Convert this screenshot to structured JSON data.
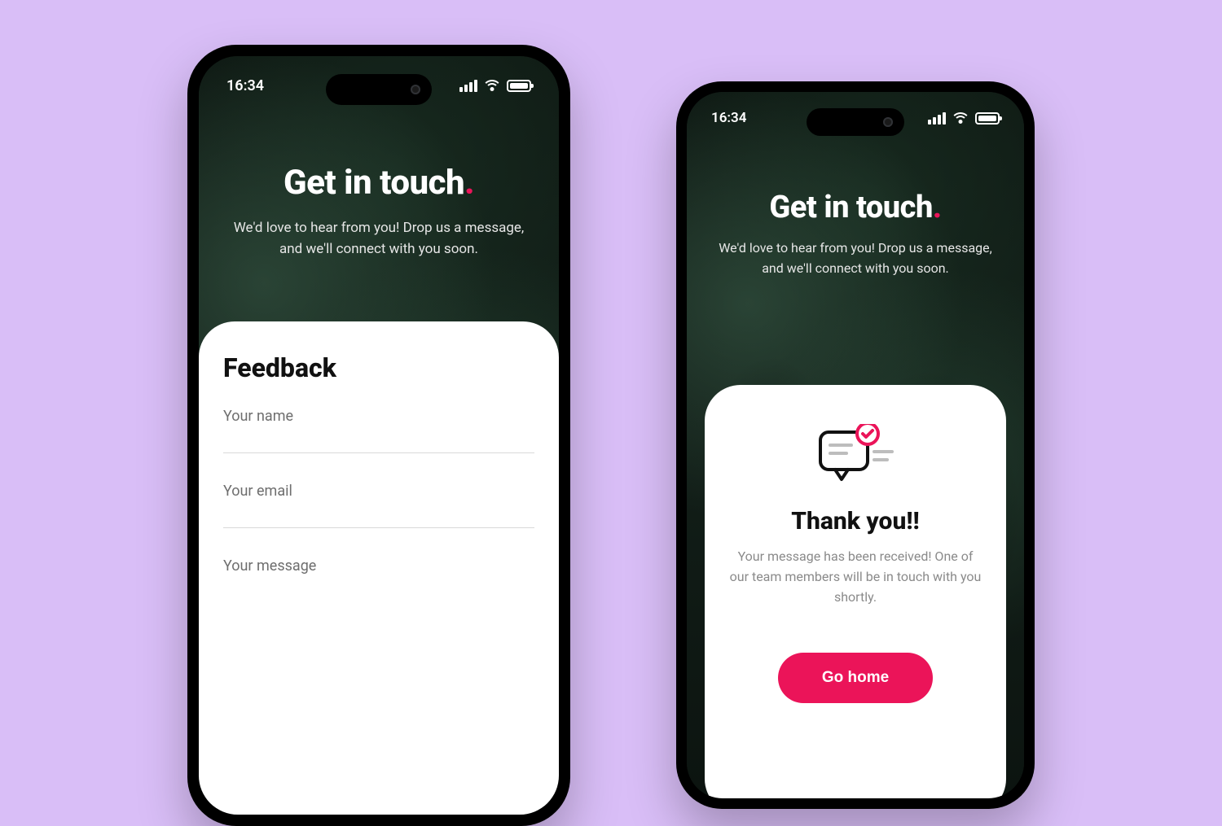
{
  "colors": {
    "accent": "#EB1459",
    "bg": "#D9BEF7"
  },
  "status": {
    "time": "16:34"
  },
  "hero": {
    "title": "Get in touch",
    "title_dot": ".",
    "subtitle": "We'd love to hear from you! Drop us a message, and we'll connect with you soon."
  },
  "form": {
    "heading": "Feedback",
    "fields": {
      "name": {
        "label": "Your name",
        "value": ""
      },
      "email": {
        "label": "Your email",
        "value": ""
      },
      "message": {
        "label": "Your message",
        "value": ""
      }
    }
  },
  "thank_you": {
    "heading": "Thank you!!",
    "body": "Your message has been received! One of our team members will be in touch with you shortly.",
    "cta": "Go home"
  }
}
